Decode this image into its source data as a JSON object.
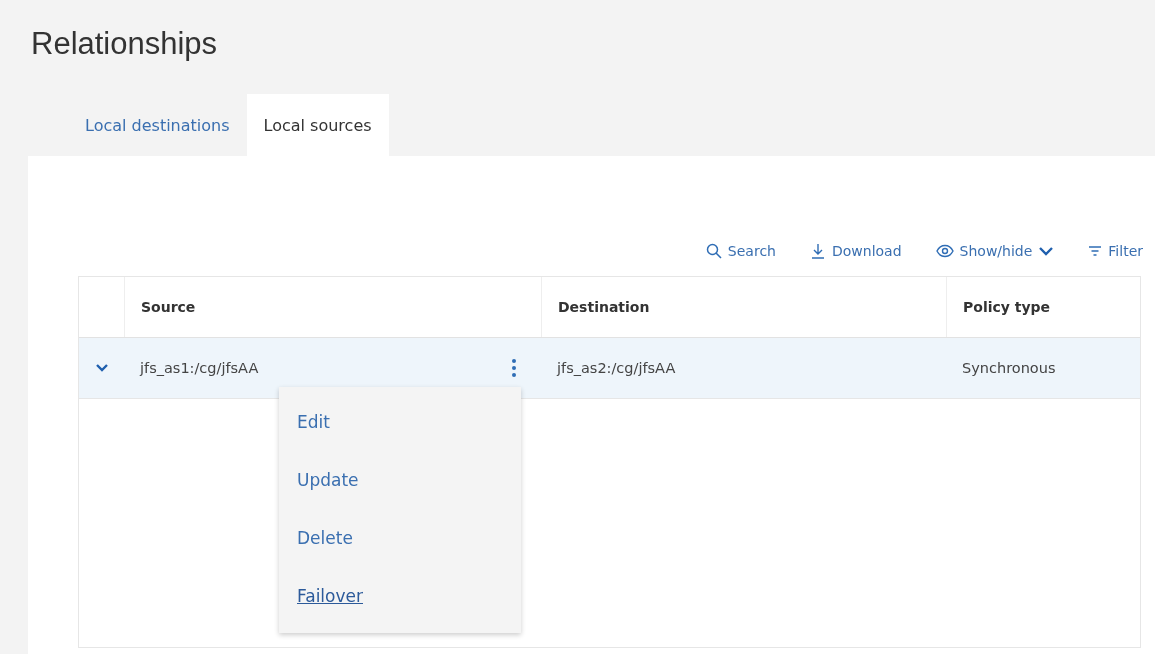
{
  "page": {
    "title": "Relationships"
  },
  "tabs": [
    {
      "label": "Local destinations",
      "selected": false
    },
    {
      "label": "Local sources",
      "selected": true
    }
  ],
  "toolbar": [
    {
      "kind": "search",
      "label": "Search"
    },
    {
      "kind": "download",
      "label": "Download"
    },
    {
      "kind": "showhide",
      "label": "Show/hide"
    },
    {
      "kind": "filter",
      "label": "Filter"
    }
  ],
  "table": {
    "columns": [
      "Source",
      "Destination",
      "Policy type"
    ],
    "rows": [
      {
        "expanded": true,
        "selected": true,
        "cells": [
          "jfs_as1:/cg/jfsAA",
          "jfs_as2:/cg/jfsAA",
          "Synchronous"
        ]
      }
    ]
  },
  "row_menu": {
    "items": [
      {
        "label": "Edit",
        "hovered": false
      },
      {
        "label": "Update",
        "hovered": false
      },
      {
        "label": "Delete",
        "hovered": false
      },
      {
        "label": "Failover",
        "hovered": true
      }
    ]
  }
}
